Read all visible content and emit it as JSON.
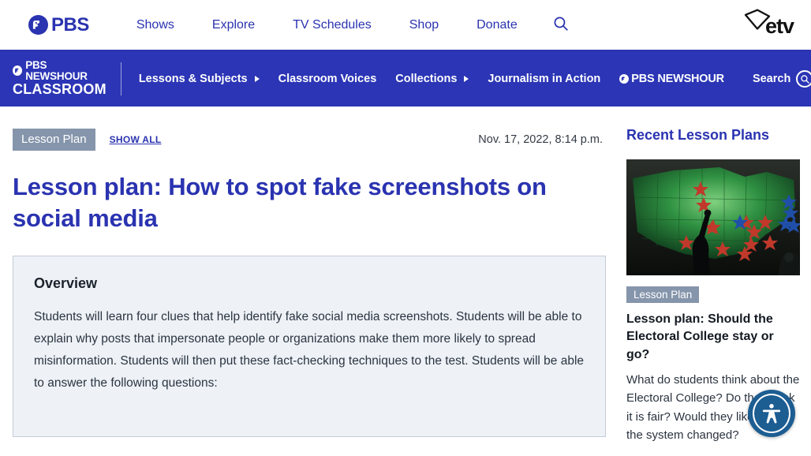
{
  "top_bar": {
    "logo": {
      "name": "PBS",
      "icon": "pbs-head-icon"
    },
    "nav": [
      {
        "label": "Shows"
      },
      {
        "label": "Explore"
      },
      {
        "label": "TV Schedules"
      },
      {
        "label": "Shop"
      },
      {
        "label": "Donate"
      }
    ],
    "search_icon": "search-icon",
    "station_logo": {
      "label": "etv",
      "icon": "south-carolina-outline-icon"
    },
    "accent_color": "#2a33b0"
  },
  "classroom_bar": {
    "logo_line1": "PBS NEWSHOUR",
    "logo_line2": "CLASSROOM",
    "nav": [
      {
        "label": "Lessons & Subjects",
        "has_caret": true
      },
      {
        "label": "Classroom Voices",
        "has_caret": false
      },
      {
        "label": "Collections",
        "has_caret": true
      },
      {
        "label": "Journalism in Action",
        "has_caret": false
      }
    ],
    "newshour_link": "PBS NEWSHOUR",
    "search_label": "Search",
    "background_color": "#2b35b5"
  },
  "article": {
    "badge": "Lesson Plan",
    "show_all": "SHOW ALL",
    "date": "Nov. 17, 2022, 8:14 p.m.",
    "headline": "Lesson plan: How to spot fake screenshots on social media",
    "overview_title": "Overview",
    "overview_text": "Students will learn four clues that help identify fake social media screenshots. Students will be able to explain why posts that impersonate people or organizations make them more likely to spread misinformation. Students will then put these fact-checking techniques to the test. Students will be able to answer the following questions:"
  },
  "sidebar": {
    "title": "Recent Lesson Plans",
    "card": {
      "image_alt": "person pointing at green electoral map with red and blue stars",
      "badge": "Lesson Plan",
      "title": "Lesson plan: Should the Electoral College stay or go?",
      "description": "What do students think about the Electoral College? Do they think it is fair? Would they like to see the system changed?"
    }
  },
  "accessibility_widget": {
    "label": "accessibility-menu",
    "color": "#1c5d92"
  }
}
